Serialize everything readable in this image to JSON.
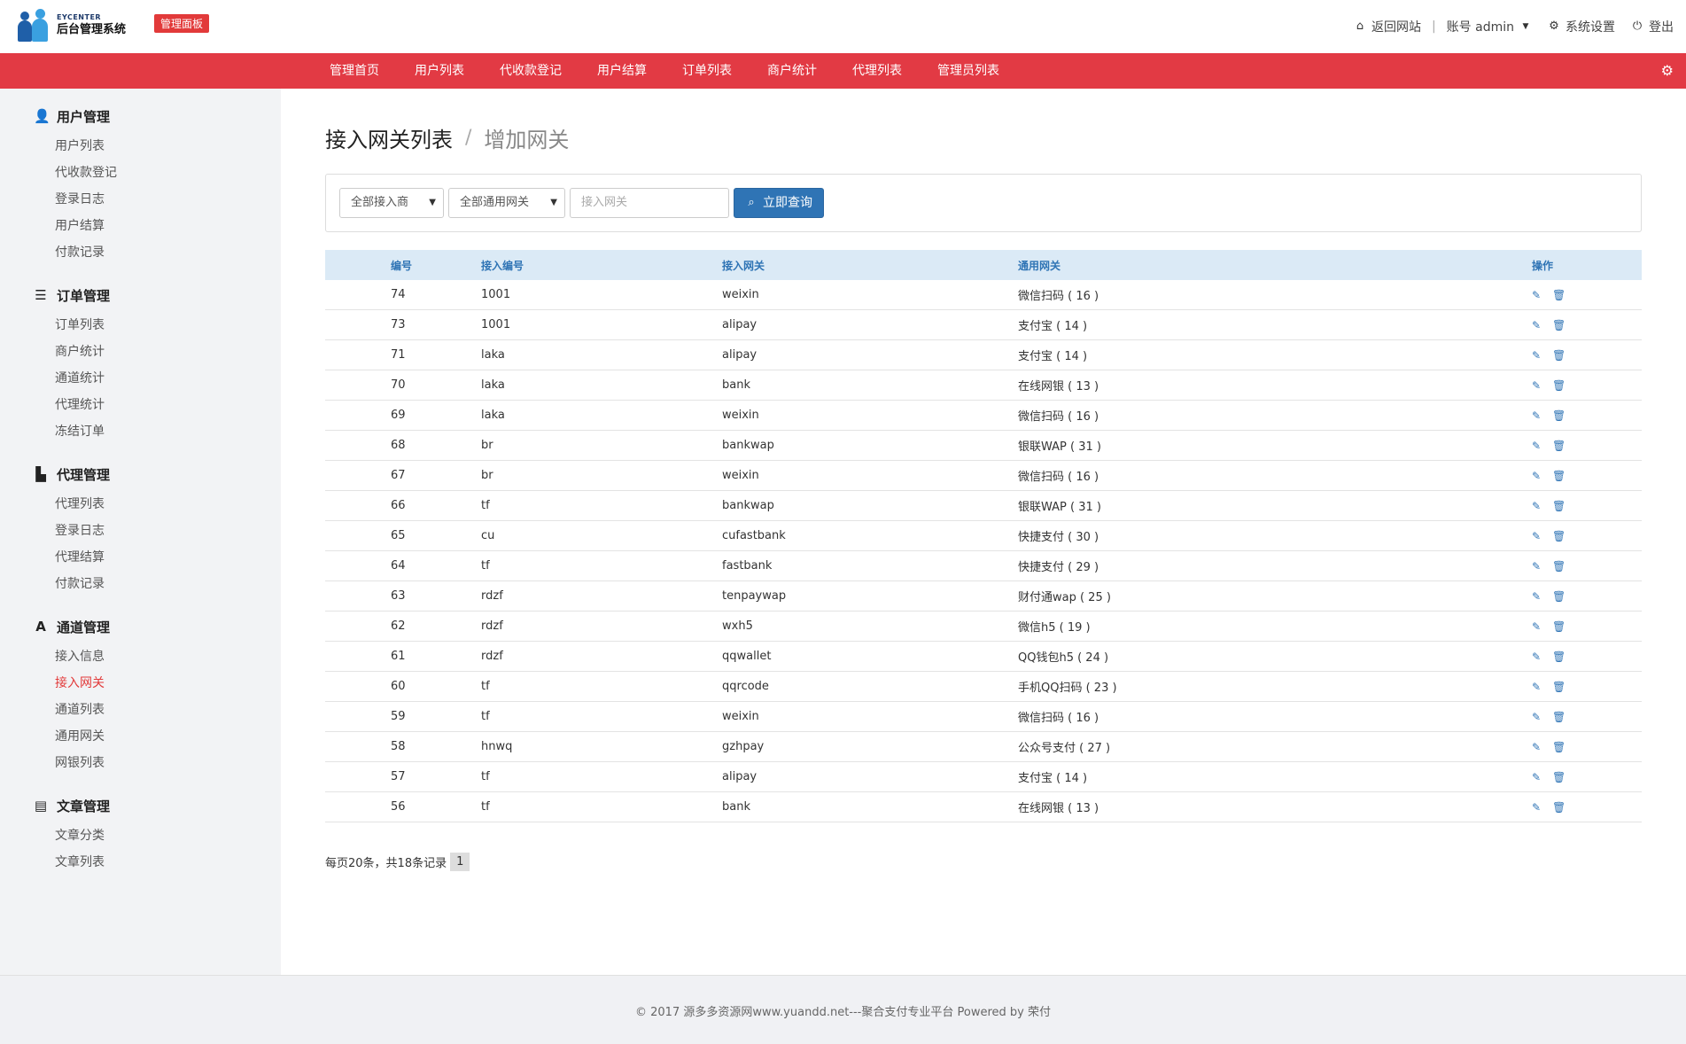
{
  "brand": {
    "small": "EYCENTER",
    "main": "后台管理系统",
    "badge": "管理面板"
  },
  "topbar": {
    "back_site": "返回网站",
    "account": "账号 admin",
    "settings": "系统设置",
    "logout": "登出"
  },
  "nav": [
    "管理首页",
    "用户列表",
    "代收款登记",
    "用户结算",
    "订单列表",
    "商户统计",
    "代理列表",
    "管理员列表"
  ],
  "sidebar": [
    {
      "title": "用户管理",
      "icon": "user-icon",
      "items": [
        "用户列表",
        "代收款登记",
        "登录日志",
        "用户结算",
        "付款记录"
      ]
    },
    {
      "title": "订单管理",
      "icon": "list-icon",
      "items": [
        "订单列表",
        "商户统计",
        "通道统计",
        "代理统计",
        "冻结订单"
      ]
    },
    {
      "title": "代理管理",
      "icon": "file-icon",
      "items": [
        "代理列表",
        "登录日志",
        "代理结算",
        "付款记录"
      ]
    },
    {
      "title": "通道管理",
      "icon": "road-icon",
      "items": [
        "接入信息",
        "接入网关",
        "通道列表",
        "通用网关",
        "网银列表"
      ]
    },
    {
      "title": "文章管理",
      "icon": "article-icon",
      "items": [
        "文章分类",
        "文章列表"
      ]
    }
  ],
  "sidebar_active": "接入网关",
  "breadcrumb": {
    "parent": "接入网关列表",
    "sep": "/",
    "current": "增加网关"
  },
  "filter": {
    "provider_select": "全部接入商",
    "gateway_select": "全部通用网关",
    "gateway_placeholder": "接入网关",
    "query_button": "立即查询"
  },
  "table": {
    "headers": [
      "编号",
      "接入编号",
      "接入网关",
      "通用网关",
      "操作"
    ],
    "rows": [
      [
        "74",
        "1001",
        "weixin",
        "微信扫码 ( 16 )"
      ],
      [
        "73",
        "1001",
        "alipay",
        "支付宝 ( 14 )"
      ],
      [
        "71",
        "laka",
        "alipay",
        "支付宝 ( 14 )"
      ],
      [
        "70",
        "laka",
        "bank",
        "在线网银 ( 13 )"
      ],
      [
        "69",
        "laka",
        "weixin",
        "微信扫码 ( 16 )"
      ],
      [
        "68",
        "br",
        "bankwap",
        "银联WAP ( 31 )"
      ],
      [
        "67",
        "br",
        "weixin",
        "微信扫码 ( 16 )"
      ],
      [
        "66",
        "tf",
        "bankwap",
        "银联WAP ( 31 )"
      ],
      [
        "65",
        "cu",
        "cufastbank",
        "快捷支付 ( 30 )"
      ],
      [
        "64",
        "tf",
        "fastbank",
        "快捷支付 ( 29 )"
      ],
      [
        "63",
        "rdzf",
        "tenpaywap",
        "财付通wap ( 25 )"
      ],
      [
        "62",
        "rdzf",
        "wxh5",
        "微信h5 ( 19 )"
      ],
      [
        "61",
        "rdzf",
        "qqwallet",
        "QQ钱包h5 ( 24 )"
      ],
      [
        "60",
        "tf",
        "qqrcode",
        "手机QQ扫码 ( 23 )"
      ],
      [
        "59",
        "tf",
        "weixin",
        "微信扫码 ( 16 )"
      ],
      [
        "58",
        "hnwq",
        "gzhpay",
        "公众号支付 ( 27 )"
      ],
      [
        "57",
        "tf",
        "alipay",
        "支付宝 ( 14 )"
      ],
      [
        "56",
        "tf",
        "bank",
        "在线网银 ( 13 )"
      ]
    ]
  },
  "pager": {
    "summary": "每页20条，共18条记录",
    "page": "1"
  },
  "footer": "© 2017  源多多资源网www.yuandd.net---聚合支付专业平台 Powered by 荣付",
  "colors": {
    "nav_red": "#e23a44",
    "primary_blue": "#2f74b5",
    "active_red": "#e23a3a"
  }
}
